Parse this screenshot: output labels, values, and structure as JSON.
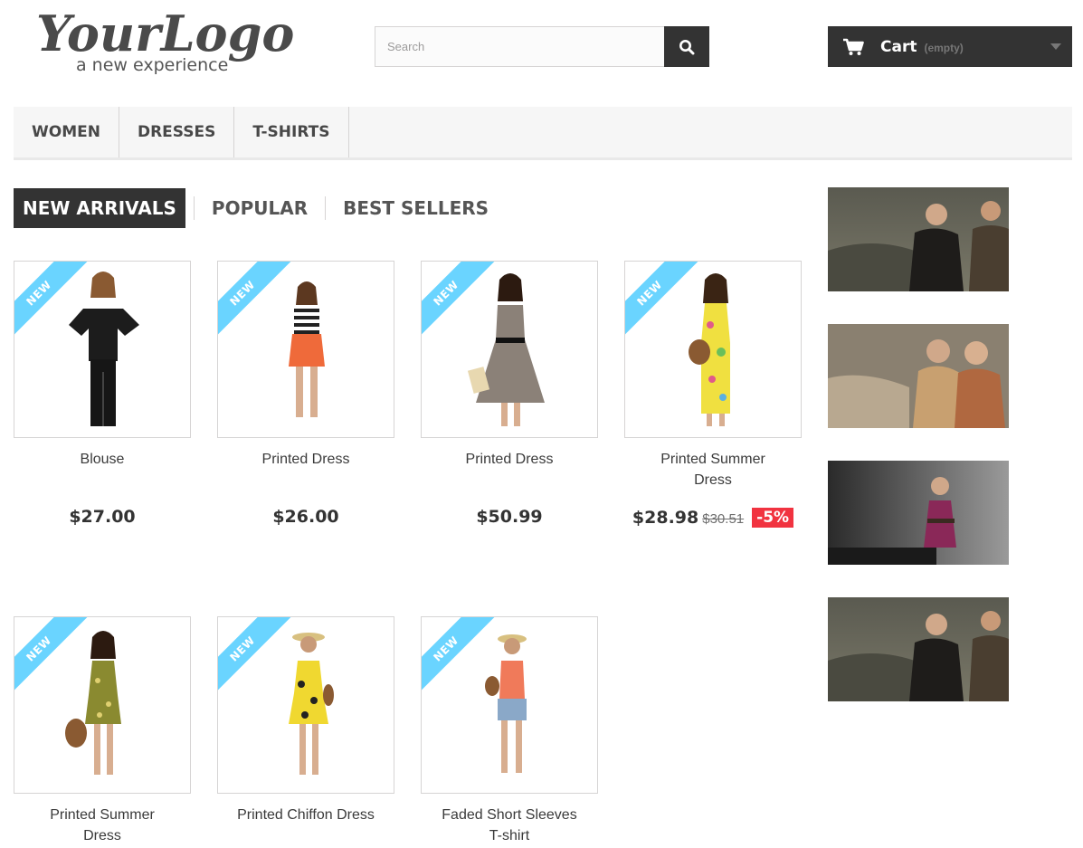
{
  "header": {
    "logo": {
      "main": "YourLogo",
      "tagline": "a new experience"
    },
    "search": {
      "placeholder": "Search"
    },
    "cart": {
      "label": "Cart",
      "status": "(empty)"
    }
  },
  "menu": {
    "items": [
      "WOMEN",
      "DRESSES",
      "T-SHIRTS"
    ]
  },
  "tabs": {
    "items": [
      "NEW ARRIVALS",
      "POPULAR",
      "BEST SELLERS"
    ],
    "active": "NEW ARRIVALS"
  },
  "products": [
    {
      "name": "Blouse",
      "price": "$27.00",
      "badge": "NEW"
    },
    {
      "name": "Printed Dress",
      "price": "$26.00",
      "badge": "NEW"
    },
    {
      "name": "Printed Dress",
      "price": "$50.99",
      "badge": "NEW"
    },
    {
      "name": "Printed Summer Dress",
      "price": "$28.98",
      "old_price": "$30.51",
      "discount": "-5%",
      "badge": "NEW"
    },
    {
      "name": "Printed Summer Dress",
      "badge": "NEW"
    },
    {
      "name": "Printed Chiffon Dress",
      "badge": "NEW"
    },
    {
      "name": "Faded Short Sleeves T-shirt",
      "badge": "NEW"
    }
  ],
  "colors": {
    "dark": "#333333",
    "ribbon": "#6ad4ff",
    "discount": "#f13340",
    "menu_bg": "#f6f6f6",
    "border": "#d6d4d4"
  },
  "icons": {
    "search_button": "magnifier-icon",
    "cart": "shopping-cart-icon",
    "cart_dropdown": "caret-down-icon"
  }
}
